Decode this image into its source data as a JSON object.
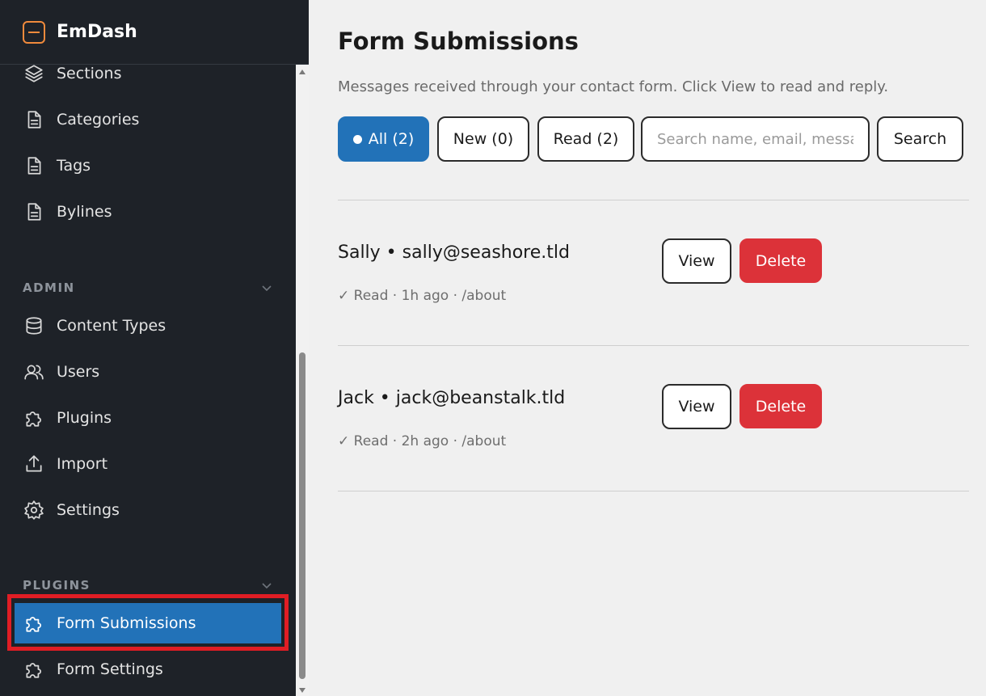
{
  "app": {
    "name": "EmDash"
  },
  "sidebar": {
    "content_items": [
      {
        "label": "Sections",
        "icon": "layers-icon"
      },
      {
        "label": "Categories",
        "icon": "document-icon"
      },
      {
        "label": "Tags",
        "icon": "document-icon"
      },
      {
        "label": "Bylines",
        "icon": "document-icon"
      }
    ],
    "admin_header": "ADMIN",
    "admin_items": [
      {
        "label": "Content Types",
        "icon": "database-icon"
      },
      {
        "label": "Users",
        "icon": "users-icon"
      },
      {
        "label": "Plugins",
        "icon": "puzzle-icon"
      },
      {
        "label": "Import",
        "icon": "upload-icon"
      },
      {
        "label": "Settings",
        "icon": "gear-icon"
      }
    ],
    "plugins_header": "PLUGINS",
    "plugin_items": [
      {
        "label": "Form Submissions",
        "icon": "puzzle-icon",
        "active": true
      },
      {
        "label": "Form Settings",
        "icon": "puzzle-icon"
      }
    ]
  },
  "main": {
    "title": "Form Submissions",
    "description": "Messages received through your contact form. Click View to read and reply.",
    "filters": {
      "all": "All (2)",
      "new": "New (0)",
      "read": "Read (2)"
    },
    "search": {
      "placeholder": "Search name, email, message",
      "value": "",
      "button": "Search"
    },
    "submissions": [
      {
        "title": "Sally • sally@seashore.tld",
        "meta": "✓ Read · 1h ago · /about",
        "view": "View",
        "delete": "Delete"
      },
      {
        "title": "Jack • jack@beanstalk.tld",
        "meta": "✓ Read · 2h ago · /about",
        "view": "View",
        "delete": "Delete"
      }
    ]
  },
  "colors": {
    "sidebar_bg": "#1e2228",
    "accent": "#2272b8",
    "danger": "#dc3239",
    "brand": "#f08a3c",
    "highlight": "#e01d24"
  }
}
